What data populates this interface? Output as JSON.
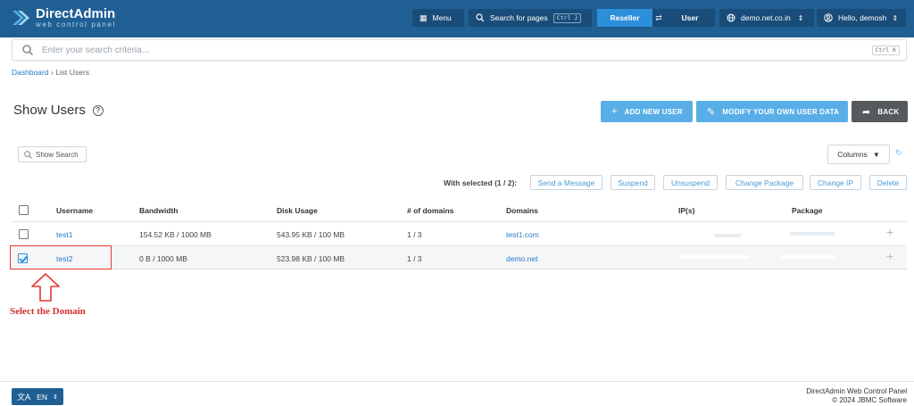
{
  "brand": {
    "name": "DirectAdmin",
    "tagline": "web control panel"
  },
  "header": {
    "menu_label": "Menu",
    "search_pages_label": "Search for pages",
    "search_pages_shortcut": "Ctrl J",
    "role_active": "Reseller",
    "role_other": "User",
    "domain_label": "demo.net.co.in",
    "user_label": "Hello, demosh"
  },
  "search": {
    "placeholder": "Enter your search criteria...",
    "shortcut": "Ctrl K"
  },
  "breadcrumb": {
    "home": "Dashboard",
    "separator": "›",
    "current": "List Users"
  },
  "page": {
    "title": "Show Users"
  },
  "actions": {
    "add_user": "ADD NEW USER",
    "modify_user": "MODIFY YOUR OWN USER DATA",
    "back": "BACK"
  },
  "toolbar": {
    "show_search": "Show Search",
    "columns": "Columns",
    "with_selected": "With selected (1 / 2):",
    "buttons": [
      "Send a Message",
      "Suspend",
      "Unsuspend",
      "Change Package",
      "Change IP",
      "Delete"
    ]
  },
  "table": {
    "headers": [
      "Username",
      "Bandwidth",
      "Disk Usage",
      "# of domains",
      "Domains",
      "IP(s)",
      "Package"
    ],
    "rows": [
      {
        "username": "test1",
        "bandwidth": "154.52 KB / 1000 MB",
        "disk": "543.95 KB / 100 MB",
        "domains_count": "1 / 3",
        "domain": "test1.com",
        "checked": false
      },
      {
        "username": "test2",
        "bandwidth": "0 B / 1000 MB",
        "disk": "523.98 KB / 100 MB",
        "domains_count": "1 / 3",
        "domain": "demo.net",
        "checked": true
      }
    ]
  },
  "annotation": {
    "label": "Select the Domain"
  },
  "footer": {
    "lang": "EN",
    "product": "DirectAdmin Web Control Panel",
    "copyright": "© 2024 JBMC Software"
  },
  "colors": {
    "header_bg": "#1f5f94",
    "accent": "#2d8fd9",
    "light_accent": "#5aaee8",
    "back_btn": "#555a5e",
    "annotation": "#d32f2f"
  }
}
